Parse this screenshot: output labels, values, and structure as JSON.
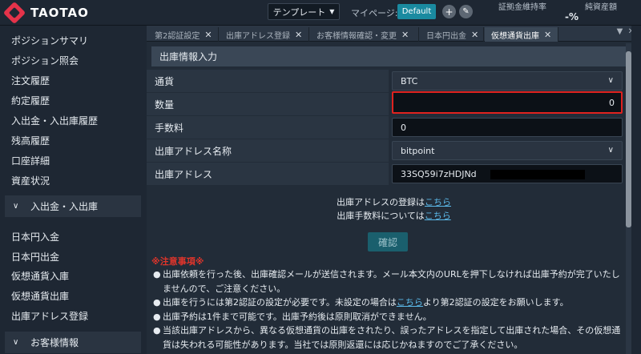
{
  "app": {
    "logo_text": "TAOTAO"
  },
  "header": {
    "template_select": "テンプレート",
    "mypage_label": "マイページ:",
    "default_badge": "Default",
    "margin_ratio_label": "証拠金維持率",
    "margin_ratio_value": "-%",
    "net_assets_label": "純資産額"
  },
  "sidebar": {
    "items_top": [
      "ポジションサマリ",
      "ポジション照会",
      "注文履歴",
      "約定履歴",
      "入出金・入出庫履歴",
      "残高履歴",
      "口座詳細",
      "資産状況"
    ],
    "section_deposit": "入出金・入出庫",
    "items_deposit": [
      "日本円入金",
      "日本円出金",
      "仮想通貨入庫",
      "仮想通貨出庫",
      "出庫アドレス登録"
    ],
    "section_customer": "お客様情報"
  },
  "tabs": [
    {
      "label": "第2認証設定",
      "active": false
    },
    {
      "label": "出庫アドレス登録",
      "active": false
    },
    {
      "label": "お客様情報確認・変更",
      "active": false
    },
    {
      "label": "日本円出金",
      "active": false
    },
    {
      "label": "仮想通貨出庫",
      "active": true
    }
  ],
  "form": {
    "section_title": "出庫情報入力",
    "currency_label": "通貨",
    "currency_value": "BTC",
    "quantity_label": "数量",
    "quantity_value": "0",
    "fee_label": "手数料",
    "fee_value": "0",
    "address_name_label": "出庫アドレス名称",
    "address_name_value": "bitpoint",
    "address_label": "出庫アドレス",
    "address_value": "33SQ59i7zHDJNd"
  },
  "links": {
    "register_prefix": "出庫アドレスの登録は",
    "register_link": "こちら",
    "fee_prefix": "出庫手数料については",
    "fee_link": "こちら"
  },
  "confirm_button": "確認",
  "notices": {
    "title": "※注意事項※",
    "item1": "出庫依頼を行った後、出庫確認メールが送信されます。メール本文内のURLを押下しなければ出庫予約が完了いたしませんので、ご注意ください。",
    "item2_prefix": "出庫を行うには第2認証の設定が必要です。未設定の場合は",
    "item2_link": "こちら",
    "item2_suffix": "より第2認証の設定をお願いします。",
    "item3": "出庫予約は1件まで可能です。出庫予約後は原則取消ができません。",
    "item4": "当該出庫アドレスから、異なる仮想通貨の出庫をされたり、誤ったアドレスを指定して出庫された場合、その仮想通貨は失われる可能性があります。当社では原則返還には応じかねますのでご了承ください。"
  },
  "icons": {
    "dropdown": "chevron-down-icon",
    "add": "plus-icon",
    "edit": "edit-icon",
    "close": "close-icon"
  },
  "colors": {
    "accent": "#1a8aa0",
    "highlight_border": "#e0221f",
    "link": "#5bb8e8",
    "notice_title": "#e0352b"
  }
}
